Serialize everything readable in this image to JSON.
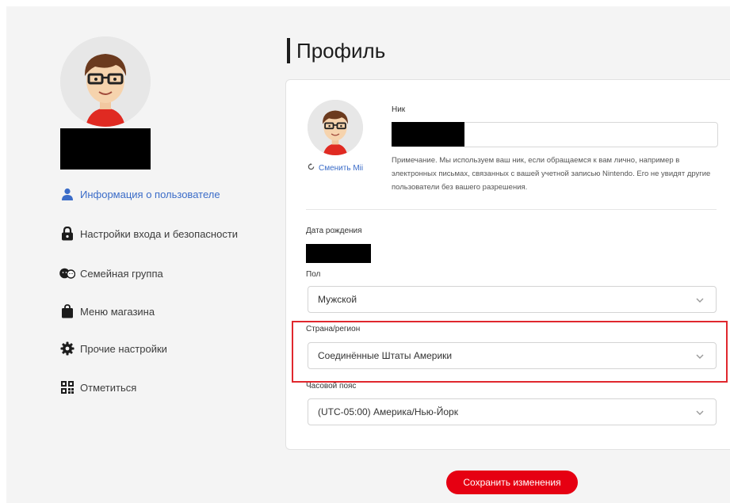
{
  "page": {
    "title": "Профиль"
  },
  "sidebar": {
    "items": [
      {
        "label": "Информация о пользователе",
        "icon": "user-icon",
        "active": true
      },
      {
        "label": "Настройки входа и безопасности",
        "icon": "lock-icon",
        "active": false
      },
      {
        "label": "Семейная группа",
        "icon": "family-icon",
        "active": false
      },
      {
        "label": "Меню магазина",
        "icon": "shopping-bag-icon",
        "active": false
      },
      {
        "label": "Прочие настройки",
        "icon": "gear-icon",
        "active": false
      },
      {
        "label": "Отметиться",
        "icon": "qr-code-icon",
        "active": false
      }
    ]
  },
  "profile": {
    "change_mii_label": "Сменить Mii",
    "nickname_label": "Ник",
    "nickname_note": "Примечание. Мы используем ваш ник, если обращаемся к вам лично, например в электронных письмах, связанных с вашей учетной записью Nintendo. Его не увидят другие пользователи без вашего разрешения.",
    "birthdate_label": "Дата рождения",
    "gender_label": "Пол",
    "gender_value": "Мужской",
    "country_label": "Страна/регион",
    "country_value": "Соединённые Штаты Америки",
    "timezone_label": "Часовой пояс",
    "timezone_value": "(UTC-05:00) Америка/Нью-Йорк"
  },
  "actions": {
    "save_label": "Сохранить изменения"
  },
  "colors": {
    "accent_blue": "#3b6cc8",
    "brand_red": "#e60012",
    "highlight_red": "#e0282e"
  }
}
